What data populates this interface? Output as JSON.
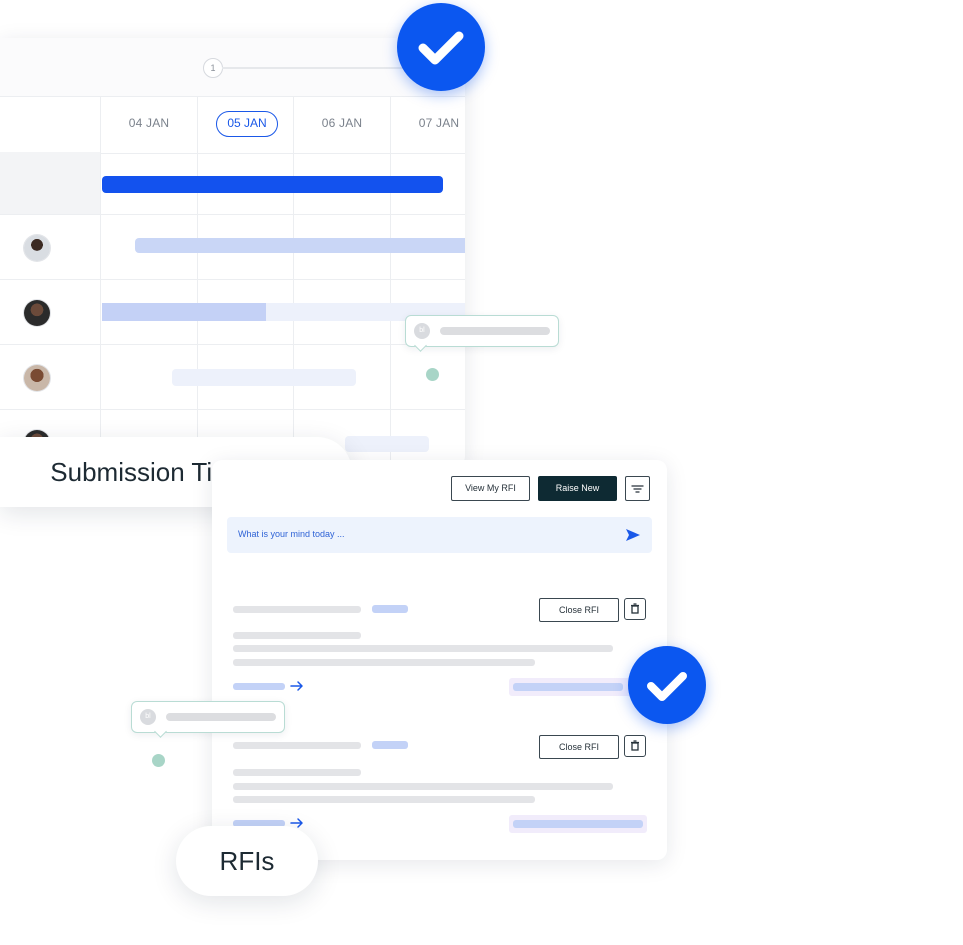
{
  "timeline": {
    "step_number": "1",
    "dates": [
      "04 JAN",
      "05 JAN",
      "06 JAN",
      "07 JAN"
    ],
    "selected_date": "05 JAN",
    "label": "Submission Timelines",
    "avatars": [
      "avatar-person-1",
      "avatar-person-2",
      "avatar-person-3",
      "avatar-person-4"
    ]
  },
  "rfi": {
    "label": "RFIs",
    "view_button": "View My RFI",
    "raise_button": "Raise New",
    "compose_placeholder": "What is your mind today ...",
    "items": [
      {
        "close_button": "Close RFI"
      },
      {
        "close_button": "Close RFI"
      }
    ]
  },
  "bubbles": {
    "initials": "bl"
  },
  "colors": {
    "accent": "#0b57f0",
    "bar_primary": "#1352ee",
    "bar_light": "#c7d4f6",
    "bubble_border": "#b9dcd4",
    "dot": "#a8d5c7",
    "dark_button": "#0e2a33"
  },
  "icons": [
    "check-icon",
    "send-icon",
    "filter-icon",
    "trash-icon",
    "arrow-right-icon"
  ]
}
